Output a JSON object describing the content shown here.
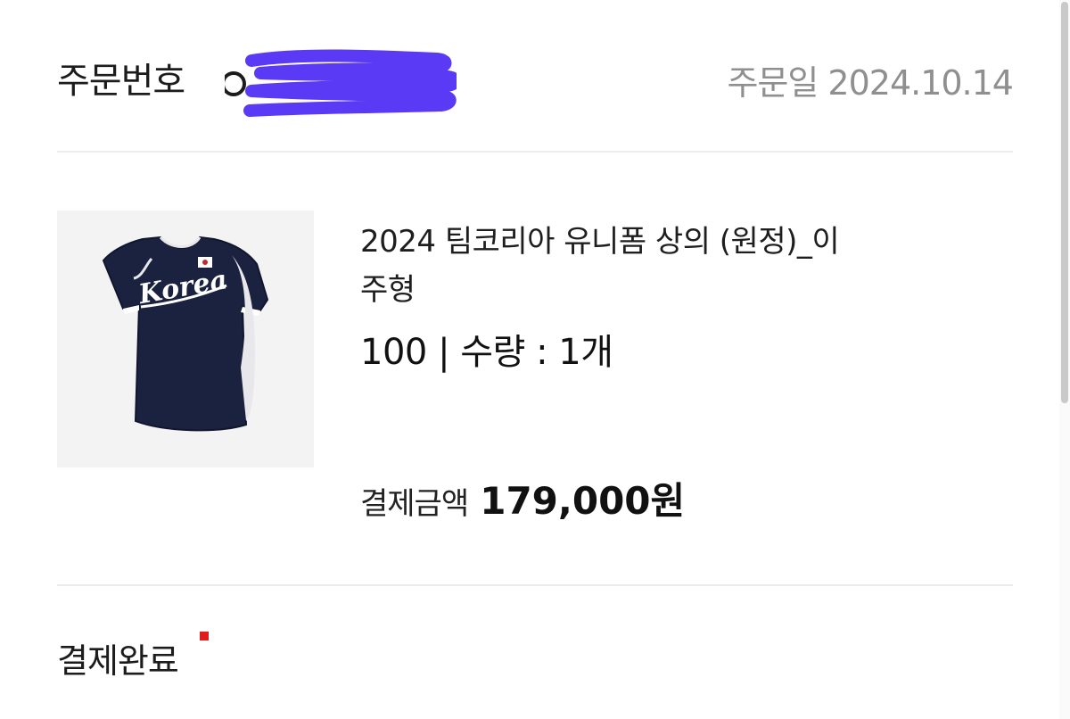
{
  "header": {
    "order_number_label": "주문번호",
    "order_date": "주문일 2024.10.14"
  },
  "product": {
    "image_alt": "baseball-jersey",
    "jersey_text": "Korea",
    "name": "2024 팀코리아 유니폼 상의 (원정)_이주형",
    "option": "100 | 수량 : 1개"
  },
  "payment": {
    "label": "결제금액",
    "amount": "179,000원"
  },
  "status": {
    "label": "결제완료",
    "indicator_color": "#e01c1c"
  },
  "colors": {
    "redaction": "#5a3af5",
    "jersey": "#1b2240"
  }
}
